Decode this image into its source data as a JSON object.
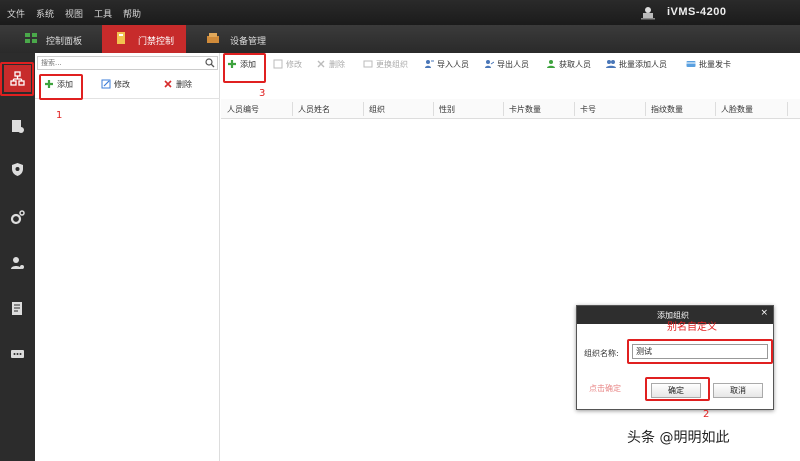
{
  "menu": {
    "items": [
      "文件",
      "系统",
      "视图",
      "工具",
      "帮助"
    ]
  },
  "app": {
    "title": "iVMS-4200"
  },
  "tabs": [
    {
      "label": "控制面板",
      "icon": "control-panel-icon"
    },
    {
      "label": "门禁控制",
      "icon": "access-control-icon",
      "active": true
    },
    {
      "label": "设备管理",
      "icon": "device-management-icon"
    }
  ],
  "rail": {
    "items": [
      "organization-icon",
      "person-card-icon",
      "shield-icon",
      "gear-icon",
      "person-config-icon",
      "report-icon",
      "more-icon"
    ]
  },
  "org_panel": {
    "search_placeholder": "搜索...",
    "add_label": "添加",
    "edit_label": "修改",
    "delete_label": "删除"
  },
  "toolbar": {
    "add": "添加",
    "edit": "修改",
    "delete": "删除",
    "change_org": "更换组织",
    "import": "导入人员",
    "export": "导出人员",
    "get": "获取人员",
    "batch_add": "批量添加人员",
    "batch_card": "批量发卡"
  },
  "table": {
    "columns": [
      "人员编号",
      "人员姓名",
      "组织",
      "性别",
      "卡片数量",
      "卡号",
      "指纹数量",
      "人脸数量"
    ]
  },
  "annotations": {
    "one": "1",
    "two": "2",
    "three": "3",
    "custom_name": "别名自定义",
    "click_confirm": "点击确定"
  },
  "dialog": {
    "title": "添加组织",
    "close": "×",
    "label": "组织名称:",
    "value": "测试",
    "ok": "确定",
    "cancel": "取消"
  },
  "watermark": "头条 @明明如此",
  "colors": {
    "accent": "#c72b2b",
    "annotation": "#e02020",
    "titlebar": "#2e2e2e"
  }
}
